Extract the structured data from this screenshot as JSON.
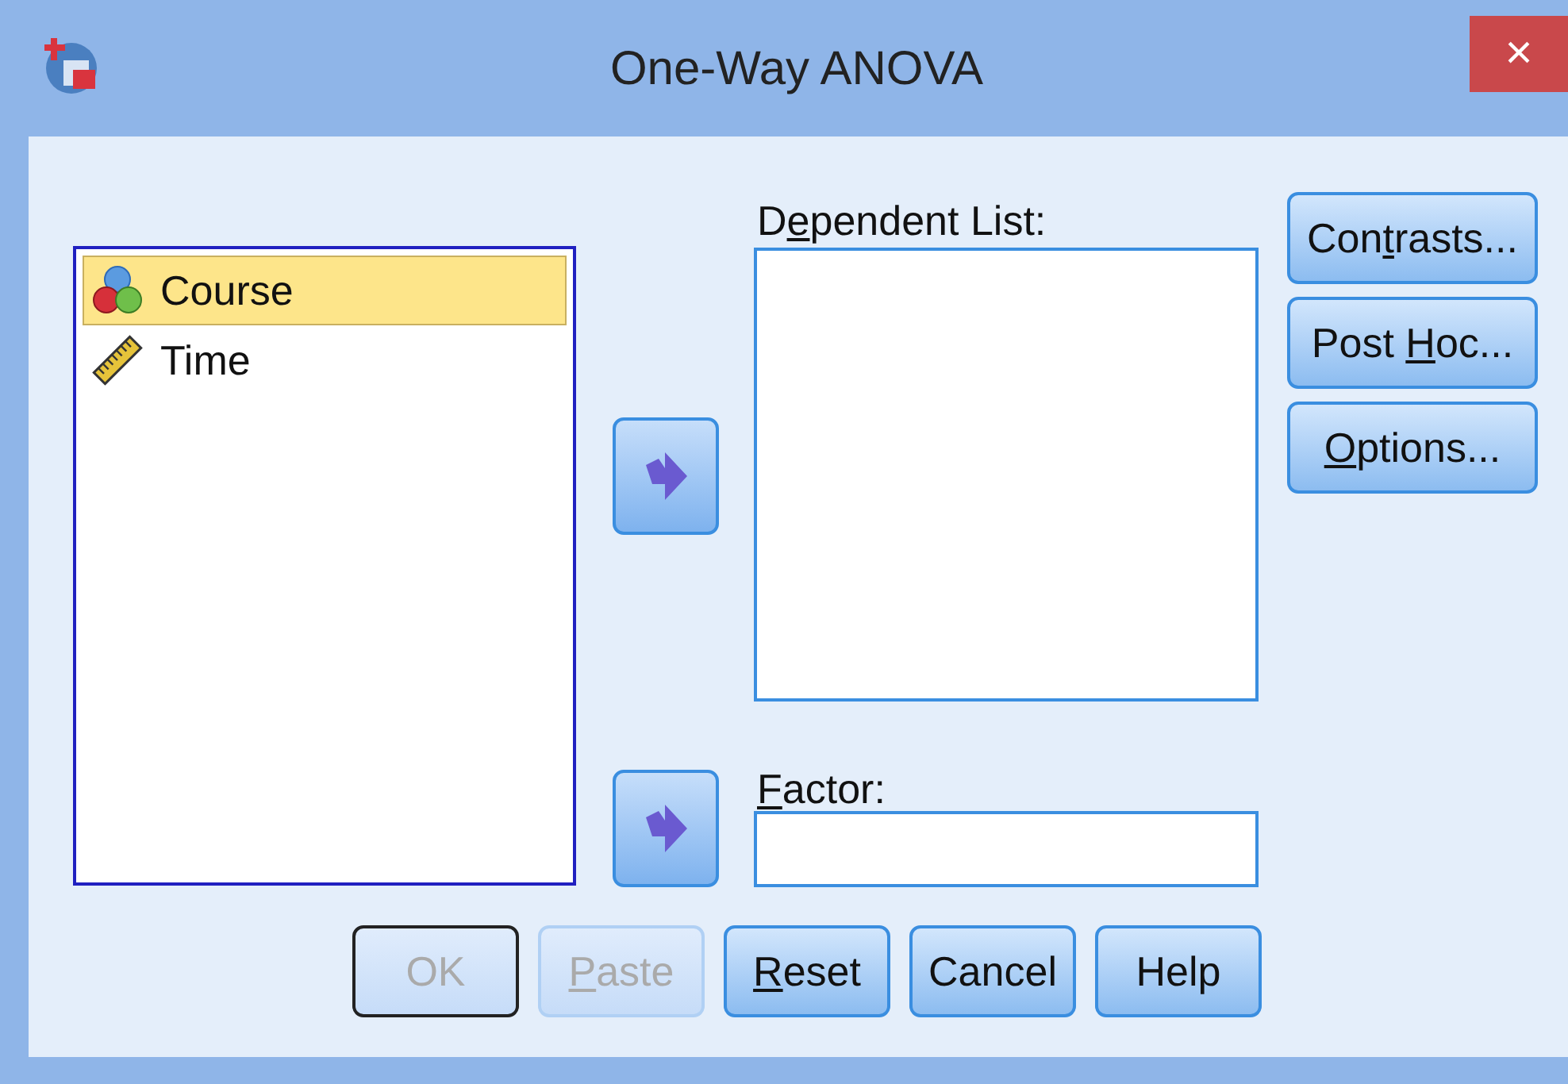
{
  "window": {
    "title": "One-Way ANOVA",
    "close": "×"
  },
  "variables": [
    {
      "kind": "nominal",
      "name": "Course",
      "selected": true
    },
    {
      "kind": "scale",
      "name": "Time",
      "selected": false
    }
  ],
  "dependent_list": {
    "label": {
      "pre": "D",
      "key": "e",
      "post": "pendent List:"
    }
  },
  "factor": {
    "label": {
      "key": "F",
      "post": "actor:"
    }
  },
  "side_buttons": [
    {
      "pre": "Con",
      "key": "t",
      "post": "rasts..."
    },
    {
      "pre": "Post ",
      "key": "H",
      "post": "oc..."
    },
    {
      "key": "O",
      "post": "ptions..."
    }
  ],
  "bottom_buttons": [
    {
      "pre": "OK",
      "disabled": true,
      "default": true
    },
    {
      "key": "P",
      "post": "aste",
      "disabled": true,
      "default": false
    },
    {
      "key": "R",
      "post": "eset",
      "disabled": false,
      "default": false
    },
    {
      "pre": "Cancel",
      "disabled": false,
      "default": false
    },
    {
      "pre": "Help",
      "disabled": false,
      "default": false
    }
  ]
}
